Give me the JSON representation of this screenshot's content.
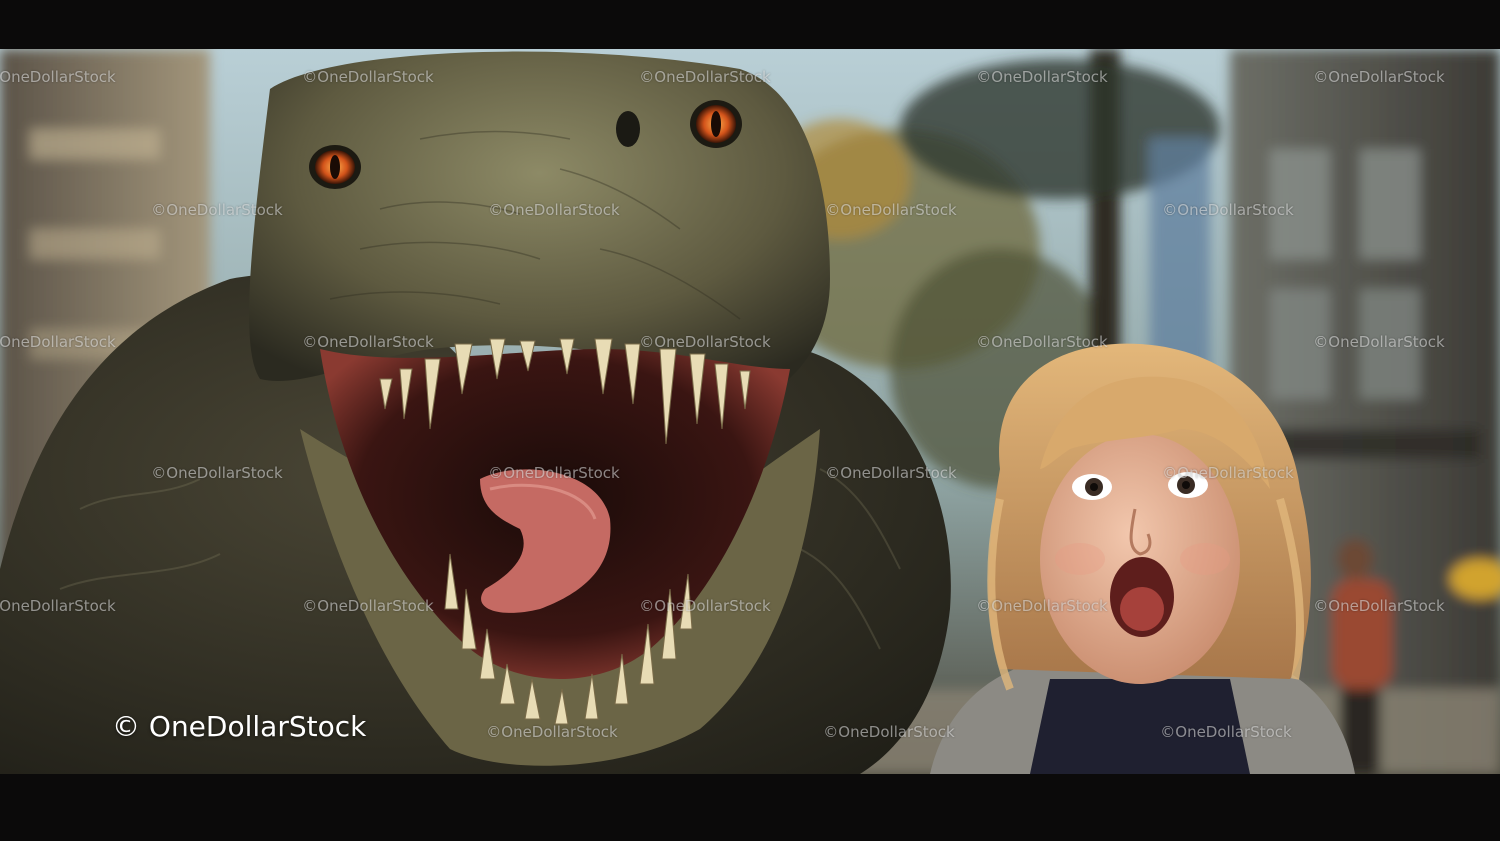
{
  "watermark": {
    "text": "©OneDollarStock"
  },
  "credit": {
    "text": "© OneDollarStock"
  },
  "colors": {
    "letterbox": "#0b0a0a",
    "sky": "#c9d6d8",
    "dino_skin": "#6e6a4a",
    "eye": "#d9561a",
    "mouth": "#7b2a25",
    "hair": "#c89a62"
  }
}
